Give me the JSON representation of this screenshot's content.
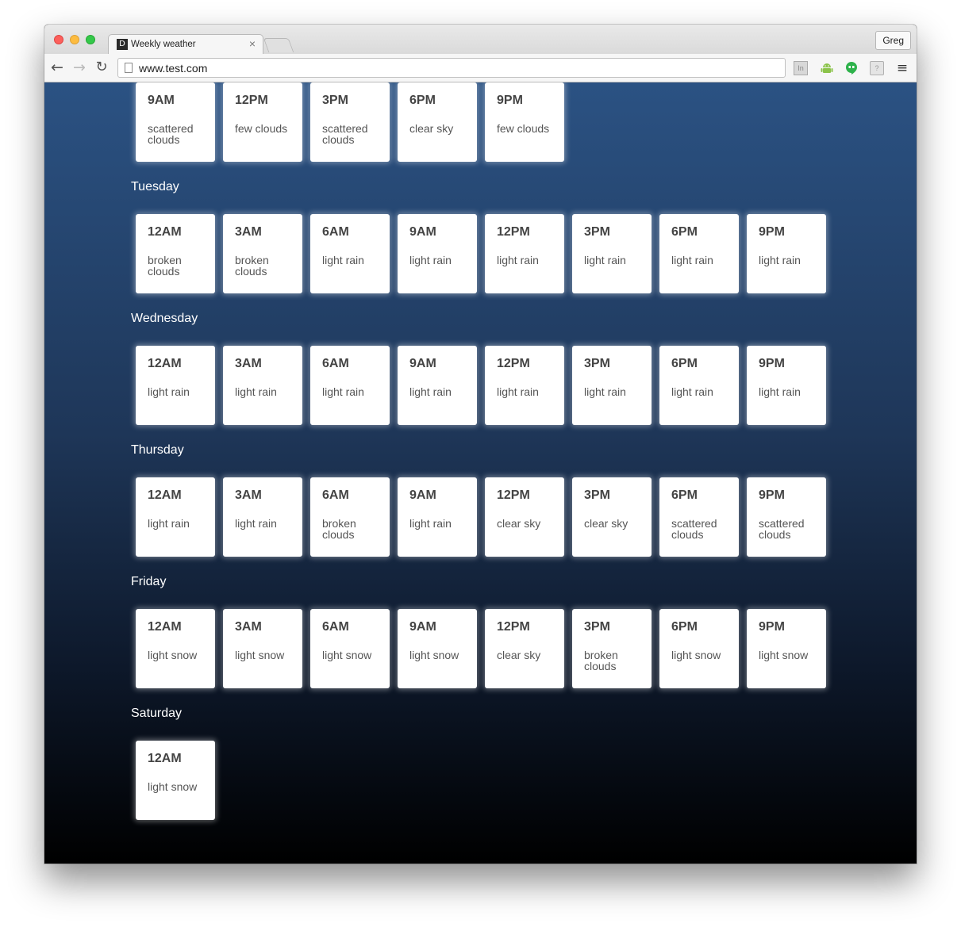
{
  "browser": {
    "tab_title": "Weekly weather",
    "tab_favicon": "D",
    "tab_close": "×",
    "profile_name": "Greg",
    "url": "www.test.com",
    "nav": {
      "back": "←",
      "forward": "→",
      "reload": "↻"
    },
    "extensions": {
      "in_label": "In",
      "help_label": "?",
      "menu": "≡"
    },
    "icons": [
      "back-arrow-icon",
      "forward-arrow-icon",
      "reload-icon",
      "page-icon",
      "linkedin-extension-icon",
      "android-icon",
      "hangouts-icon",
      "help-extension-icon",
      "menu-icon"
    ]
  },
  "days": [
    {
      "name": "",
      "forecasts": [
        {
          "time": "9AM",
          "desc": "scattered clouds"
        },
        {
          "time": "12PM",
          "desc": "few clouds"
        },
        {
          "time": "3PM",
          "desc": "scattered clouds"
        },
        {
          "time": "6PM",
          "desc": "clear sky"
        },
        {
          "time": "9PM",
          "desc": "few clouds"
        }
      ]
    },
    {
      "name": "Tuesday",
      "forecasts": [
        {
          "time": "12AM",
          "desc": "broken clouds"
        },
        {
          "time": "3AM",
          "desc": "broken clouds"
        },
        {
          "time": "6AM",
          "desc": "light rain"
        },
        {
          "time": "9AM",
          "desc": "light rain"
        },
        {
          "time": "12PM",
          "desc": "light rain"
        },
        {
          "time": "3PM",
          "desc": "light rain"
        },
        {
          "time": "6PM",
          "desc": "light rain"
        },
        {
          "time": "9PM",
          "desc": "light rain"
        }
      ]
    },
    {
      "name": "Wednesday",
      "forecasts": [
        {
          "time": "12AM",
          "desc": "light rain"
        },
        {
          "time": "3AM",
          "desc": "light rain"
        },
        {
          "time": "6AM",
          "desc": "light rain"
        },
        {
          "time": "9AM",
          "desc": "light rain"
        },
        {
          "time": "12PM",
          "desc": "light rain"
        },
        {
          "time": "3PM",
          "desc": "light rain"
        },
        {
          "time": "6PM",
          "desc": "light rain"
        },
        {
          "time": "9PM",
          "desc": "light rain"
        }
      ]
    },
    {
      "name": "Thursday",
      "forecasts": [
        {
          "time": "12AM",
          "desc": "light rain"
        },
        {
          "time": "3AM",
          "desc": "light rain"
        },
        {
          "time": "6AM",
          "desc": "broken clouds"
        },
        {
          "time": "9AM",
          "desc": "light rain"
        },
        {
          "time": "12PM",
          "desc": "clear sky"
        },
        {
          "time": "3PM",
          "desc": "clear sky"
        },
        {
          "time": "6PM",
          "desc": "scattered clouds"
        },
        {
          "time": "9PM",
          "desc": "scattered clouds"
        }
      ]
    },
    {
      "name": "Friday",
      "forecasts": [
        {
          "time": "12AM",
          "desc": "light snow"
        },
        {
          "time": "3AM",
          "desc": "light snow"
        },
        {
          "time": "6AM",
          "desc": "light snow"
        },
        {
          "time": "9AM",
          "desc": "light snow"
        },
        {
          "time": "12PM",
          "desc": "clear sky"
        },
        {
          "time": "3PM",
          "desc": "broken clouds"
        },
        {
          "time": "6PM",
          "desc": "light snow"
        },
        {
          "time": "9PM",
          "desc": "light snow"
        }
      ]
    },
    {
      "name": "Saturday",
      "forecasts": [
        {
          "time": "12AM",
          "desc": "light snow"
        }
      ]
    }
  ]
}
